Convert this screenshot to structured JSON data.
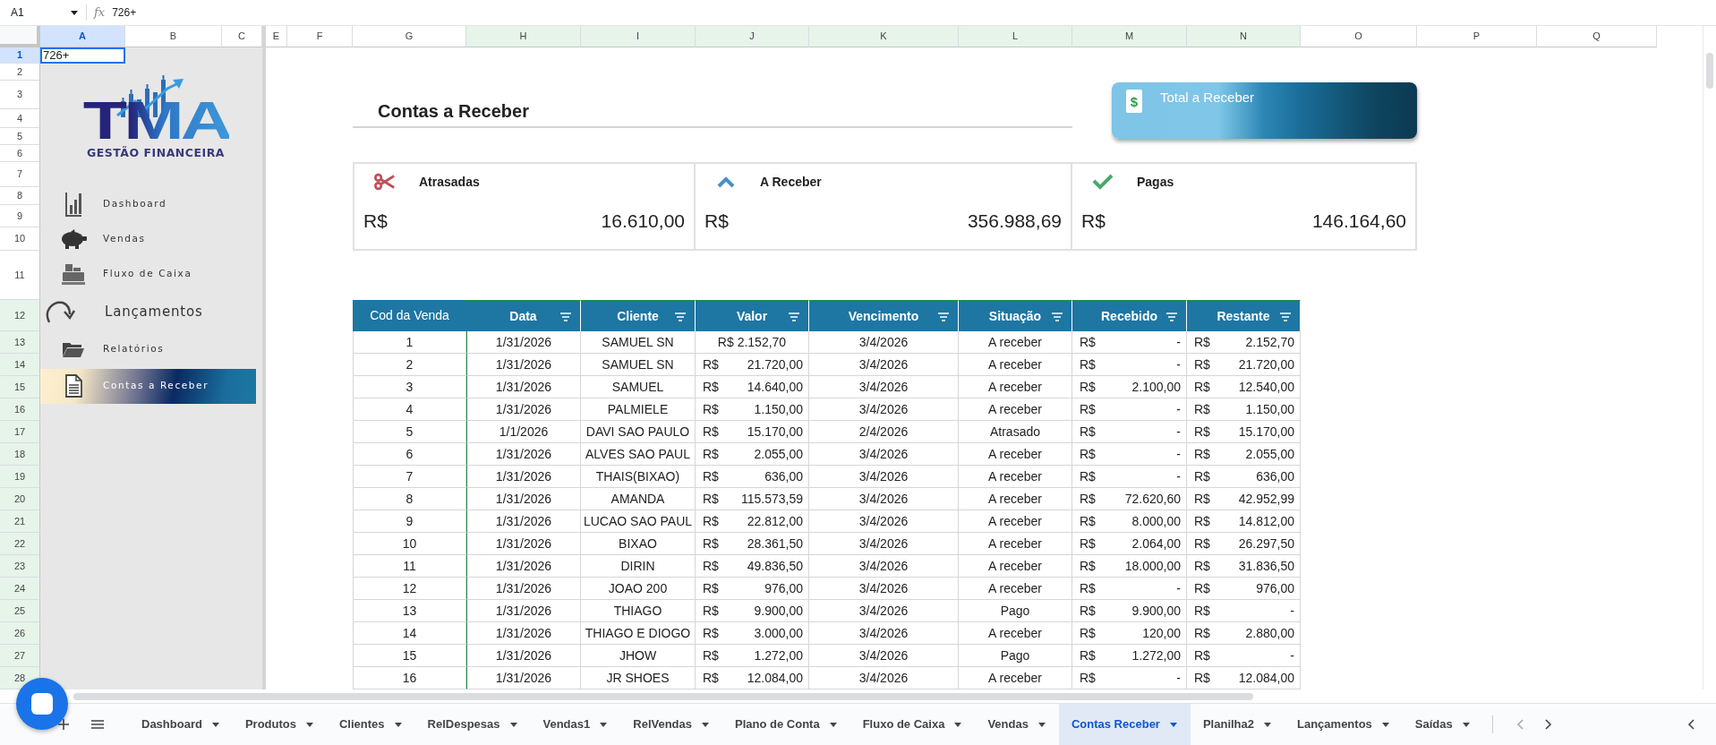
{
  "formula_bar": {
    "cell_ref": "A1",
    "fx": "fx",
    "value": "726+"
  },
  "columns": [
    {
      "label": "A",
      "selected": true,
      "in_range": false
    },
    {
      "label": "B",
      "selected": false,
      "in_range": false
    },
    {
      "label": "C",
      "selected": false,
      "in_range": false
    },
    {
      "label": "E",
      "selected": false,
      "in_range": false
    },
    {
      "label": "F",
      "selected": false,
      "in_range": false
    },
    {
      "label": "G",
      "selected": false,
      "in_range": false
    },
    {
      "label": "H",
      "selected": false,
      "in_range": true
    },
    {
      "label": "I",
      "selected": false,
      "in_range": true
    },
    {
      "label": "J",
      "selected": false,
      "in_range": true
    },
    {
      "label": "K",
      "selected": false,
      "in_range": true
    },
    {
      "label": "L",
      "selected": false,
      "in_range": true
    },
    {
      "label": "M",
      "selected": false,
      "in_range": true
    },
    {
      "label": "N",
      "selected": false,
      "in_range": true
    },
    {
      "label": "O",
      "selected": false,
      "in_range": false
    },
    {
      "label": "P",
      "selected": false,
      "in_range": false
    },
    {
      "label": "Q",
      "selected": false,
      "in_range": false
    }
  ],
  "rows": [
    {
      "label": "1",
      "selected": true,
      "in_range": false
    },
    {
      "label": "2",
      "selected": false,
      "in_range": false
    },
    {
      "label": "3",
      "selected": false,
      "in_range": false
    },
    {
      "label": "4",
      "selected": false,
      "in_range": false
    },
    {
      "label": "5",
      "selected": false,
      "in_range": false
    },
    {
      "label": "6",
      "selected": false,
      "in_range": false
    },
    {
      "label": "7",
      "selected": false,
      "in_range": false
    },
    {
      "label": "8",
      "selected": false,
      "in_range": false
    },
    {
      "label": "9",
      "selected": false,
      "in_range": false
    },
    {
      "label": "10",
      "selected": false,
      "in_range": false
    },
    {
      "label": "11",
      "selected": false,
      "in_range": false
    },
    {
      "label": "12",
      "selected": false,
      "in_range": true
    },
    {
      "label": "13",
      "selected": false,
      "in_range": true
    },
    {
      "label": "14",
      "selected": false,
      "in_range": true
    },
    {
      "label": "15",
      "selected": false,
      "in_range": true
    },
    {
      "label": "16",
      "selected": false,
      "in_range": true
    },
    {
      "label": "17",
      "selected": false,
      "in_range": true
    },
    {
      "label": "18",
      "selected": false,
      "in_range": true
    },
    {
      "label": "19",
      "selected": false,
      "in_range": true
    },
    {
      "label": "20",
      "selected": false,
      "in_range": true
    },
    {
      "label": "21",
      "selected": false,
      "in_range": true
    },
    {
      "label": "22",
      "selected": false,
      "in_range": true
    },
    {
      "label": "23",
      "selected": false,
      "in_range": true
    },
    {
      "label": "24",
      "selected": false,
      "in_range": true
    },
    {
      "label": "25",
      "selected": false,
      "in_range": true
    },
    {
      "label": "26",
      "selected": false,
      "in_range": true
    },
    {
      "label": "27",
      "selected": false,
      "in_range": true
    },
    {
      "label": "28",
      "selected": false,
      "in_range": true
    }
  ],
  "cell_a1": "726+",
  "logo": {
    "mark": "TMA",
    "tagline": "GESTÃO FINANCEIRA"
  },
  "sidebar": {
    "items": [
      {
        "label": "Dashboard",
        "kind": "chart",
        "selected": false
      },
      {
        "label": "Vendas",
        "kind": "piggy",
        "selected": false
      },
      {
        "label": "Fluxo de Caixa",
        "kind": "register",
        "selected": false
      },
      {
        "label": "Lançamentos",
        "kind": "redo",
        "selected": false
      },
      {
        "label": "Relatórios",
        "kind": "folder",
        "selected": false
      },
      {
        "label": "Contas a Receber",
        "kind": "document",
        "selected": true
      }
    ]
  },
  "page_title": "Contas a Receber",
  "total_button": {
    "label": "Total a Receber",
    "icon_glyph": "$"
  },
  "summary_cards": [
    {
      "kind": "late",
      "label": "Atrasadas",
      "currency": "R$",
      "amount": "16.610,00"
    },
    {
      "kind": "receivable",
      "label": "A Receber",
      "currency": "R$",
      "amount": "356.988,69"
    },
    {
      "kind": "paid",
      "label": "Pagas",
      "currency": "R$",
      "amount": "146.164,60"
    }
  ],
  "table": {
    "columns": [
      {
        "label": "Cod da Venda",
        "filter": false
      },
      {
        "label": "Data",
        "filter": true
      },
      {
        "label": "Cliente",
        "filter": true
      },
      {
        "label": "Valor",
        "filter": true
      },
      {
        "label": "Vencimento",
        "filter": true
      },
      {
        "label": "Situação",
        "filter": true
      },
      {
        "label": "Recebido",
        "filter": true
      },
      {
        "label": "Restante",
        "filter": true
      }
    ],
    "rows": [
      {
        "cod": "1",
        "data": "1/31/2026",
        "cliente": "SAMUEL SN",
        "valor": {
          "text": "R$ 2.152,70"
        },
        "vencimento": "3/4/2026",
        "situacao": "A receber",
        "recebido": {
          "currency": "R$",
          "amount": "-"
        },
        "restante": {
          "currency": "R$",
          "amount": "2.152,70"
        }
      },
      {
        "cod": "2",
        "data": "1/31/2026",
        "cliente": "SAMUEL SN",
        "valor": {
          "currency": "R$",
          "amount": "21.720,00"
        },
        "vencimento": "3/4/2026",
        "situacao": "A receber",
        "recebido": {
          "currency": "R$",
          "amount": "-"
        },
        "restante": {
          "currency": "R$",
          "amount": "21.720,00"
        }
      },
      {
        "cod": "3",
        "data": "1/31/2026",
        "cliente": "SAMUEL",
        "valor": {
          "currency": "R$",
          "amount": "14.640,00"
        },
        "vencimento": "3/4/2026",
        "situacao": "A receber",
        "recebido": {
          "currency": "R$",
          "amount": "2.100,00"
        },
        "restante": {
          "currency": "R$",
          "amount": "12.540,00"
        }
      },
      {
        "cod": "4",
        "data": "1/31/2026",
        "cliente": "PALMIELE",
        "valor": {
          "currency": "R$",
          "amount": "1.150,00"
        },
        "vencimento": "3/4/2026",
        "situacao": "A receber",
        "recebido": {
          "currency": "R$",
          "amount": "-"
        },
        "restante": {
          "currency": "R$",
          "amount": "1.150,00"
        }
      },
      {
        "cod": "5",
        "data": "1/1/2026",
        "cliente": "DAVI SAO PAULO",
        "valor": {
          "currency": "R$",
          "amount": "15.170,00"
        },
        "vencimento": "2/4/2026",
        "situacao": "Atrasado",
        "recebido": {
          "currency": "R$",
          "amount": "-"
        },
        "restante": {
          "currency": "R$",
          "amount": "15.170,00"
        }
      },
      {
        "cod": "6",
        "data": "1/31/2026",
        "cliente": "ALVES SAO PAUL",
        "valor": {
          "currency": "R$",
          "amount": "2.055,00"
        },
        "vencimento": "3/4/2026",
        "situacao": "A receber",
        "recebido": {
          "currency": "R$",
          "amount": "-"
        },
        "restante": {
          "currency": "R$",
          "amount": "2.055,00"
        }
      },
      {
        "cod": "7",
        "data": "1/31/2026",
        "cliente": "THAIS(BIXAO)",
        "valor": {
          "currency": "R$",
          "amount": "636,00"
        },
        "vencimento": "3/4/2026",
        "situacao": "A receber",
        "recebido": {
          "currency": "R$",
          "amount": "-"
        },
        "restante": {
          "currency": "R$",
          "amount": "636,00"
        }
      },
      {
        "cod": "8",
        "data": "1/31/2026",
        "cliente": "AMANDA",
        "valor": {
          "currency": "R$",
          "amount": "115.573,59"
        },
        "vencimento": "3/4/2026",
        "situacao": "A receber",
        "recebido": {
          "currency": "R$",
          "amount": "72.620,60"
        },
        "restante": {
          "currency": "R$",
          "amount": "42.952,99"
        }
      },
      {
        "cod": "9",
        "data": "1/31/2026",
        "cliente": "LUCAO SAO PAUL",
        "valor": {
          "currency": "R$",
          "amount": "22.812,00"
        },
        "vencimento": "3/4/2026",
        "situacao": "A receber",
        "recebido": {
          "currency": "R$",
          "amount": "8.000,00"
        },
        "restante": {
          "currency": "R$",
          "amount": "14.812,00"
        }
      },
      {
        "cod": "10",
        "data": "1/31/2026",
        "cliente": "BIXAO",
        "valor": {
          "currency": "R$",
          "amount": "28.361,50"
        },
        "vencimento": "3/4/2026",
        "situacao": "A receber",
        "recebido": {
          "currency": "R$",
          "amount": "2.064,00"
        },
        "restante": {
          "currency": "R$",
          "amount": "26.297,50"
        }
      },
      {
        "cod": "11",
        "data": "1/31/2026",
        "cliente": "DIRIN",
        "valor": {
          "currency": "R$",
          "amount": "49.836,50"
        },
        "vencimento": "3/4/2026",
        "situacao": "A receber",
        "recebido": {
          "currency": "R$",
          "amount": "18.000,00"
        },
        "restante": {
          "currency": "R$",
          "amount": "31.836,50"
        }
      },
      {
        "cod": "12",
        "data": "1/31/2026",
        "cliente": "JOAO 200",
        "valor": {
          "currency": "R$",
          "amount": "976,00"
        },
        "vencimento": "3/4/2026",
        "situacao": "A receber",
        "recebido": {
          "currency": "R$",
          "amount": "-"
        },
        "restante": {
          "currency": "R$",
          "amount": "976,00"
        }
      },
      {
        "cod": "13",
        "data": "1/31/2026",
        "cliente": "THIAGO",
        "valor": {
          "currency": "R$",
          "amount": "9.900,00"
        },
        "vencimento": "3/4/2026",
        "situacao": "Pago",
        "recebido": {
          "currency": "R$",
          "amount": "9.900,00"
        },
        "restante": {
          "currency": "R$",
          "amount": "-"
        }
      },
      {
        "cod": "14",
        "data": "1/31/2026",
        "cliente": "THIAGO E DIOGO",
        "valor": {
          "currency": "R$",
          "amount": "3.000,00"
        },
        "vencimento": "3/4/2026",
        "situacao": "A receber",
        "recebido": {
          "currency": "R$",
          "amount": "120,00"
        },
        "restante": {
          "currency": "R$",
          "amount": "2.880,00"
        }
      },
      {
        "cod": "15",
        "data": "1/31/2026",
        "cliente": "JHOW",
        "valor": {
          "currency": "R$",
          "amount": "1.272,00"
        },
        "vencimento": "3/4/2026",
        "situacao": "Pago",
        "recebido": {
          "currency": "R$",
          "amount": "1.272,00"
        },
        "restante": {
          "currency": "R$",
          "amount": "-"
        }
      },
      {
        "cod": "16",
        "data": "1/31/2026",
        "cliente": "JR SHOES",
        "valor": {
          "currency": "R$",
          "amount": "12.084,00"
        },
        "vencimento": "3/4/2026",
        "situacao": "A receber",
        "recebido": {
          "currency": "R$",
          "amount": "-"
        },
        "restante": {
          "currency": "R$",
          "amount": "12.084,00"
        }
      }
    ]
  },
  "sheet_tabs": [
    {
      "label": "Dashboard",
      "selected": false
    },
    {
      "label": "Produtos",
      "selected": false
    },
    {
      "label": "Clientes",
      "selected": false
    },
    {
      "label": "RelDespesas",
      "selected": false
    },
    {
      "label": "Vendas1",
      "selected": false
    },
    {
      "label": "RelVendas",
      "selected": false
    },
    {
      "label": "Plano de Conta",
      "selected": false
    },
    {
      "label": "Fluxo de Caixa",
      "selected": false
    },
    {
      "label": "Vendas",
      "selected": false
    },
    {
      "label": "Contas Receber",
      "selected": true
    },
    {
      "label": "Planilha2",
      "selected": false
    },
    {
      "label": "Lançamentos",
      "selected": false
    },
    {
      "label": "Saídas",
      "selected": false
    }
  ]
}
